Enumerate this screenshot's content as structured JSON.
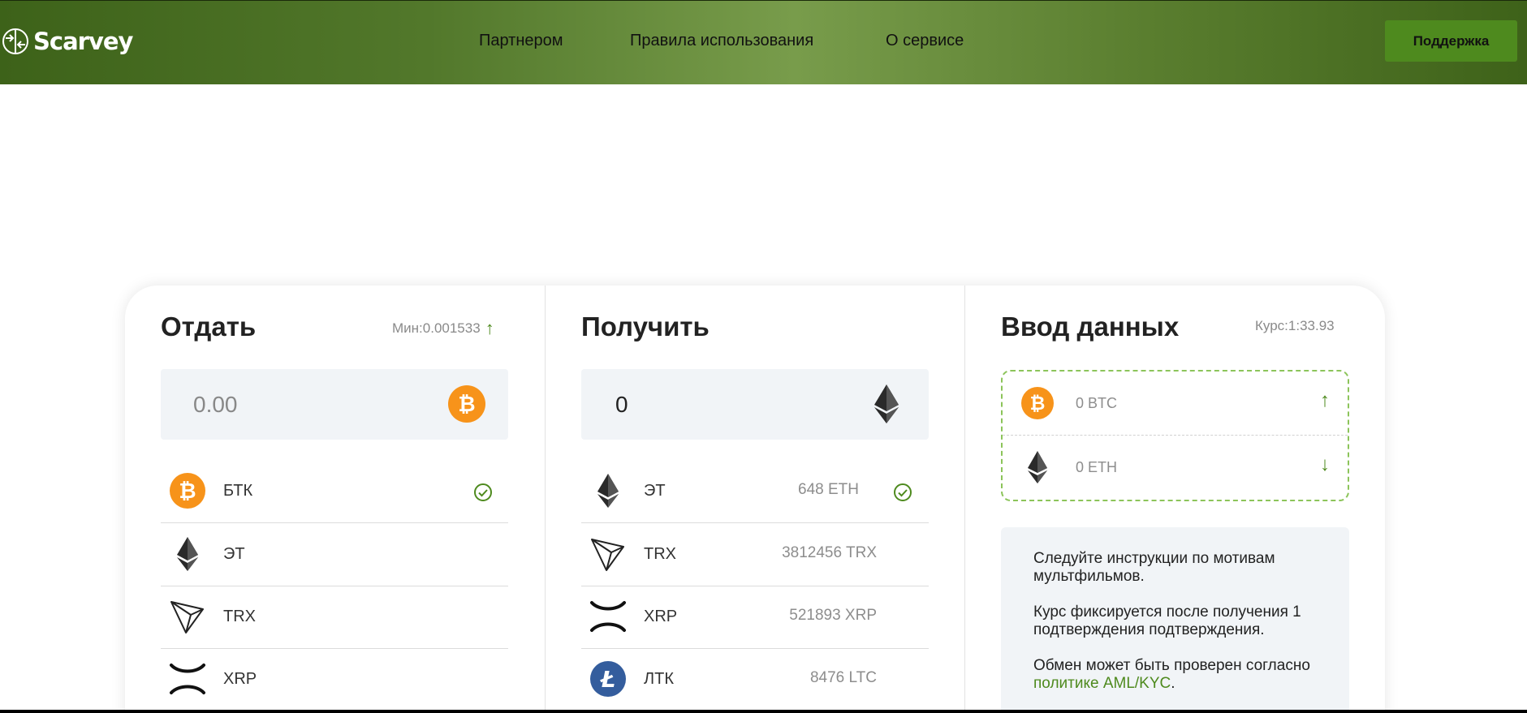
{
  "header": {
    "logo_text": "Scarvey",
    "nav": [
      "Партнером",
      "Правила использования",
      "О сервисе"
    ],
    "support_label": "Поддержка"
  },
  "give": {
    "title": "Отдать",
    "min_label": "Мин:0.001533",
    "amount": "0.00",
    "coins": [
      {
        "name": "БТК",
        "icon": "bitcoin-icon",
        "selected": true
      },
      {
        "name": "ЭТ",
        "icon": "ethereum-icon",
        "selected": false
      },
      {
        "name": "TRX",
        "icon": "tron-icon",
        "selected": false
      },
      {
        "name": "XRP",
        "icon": "xrp-icon",
        "selected": false
      }
    ]
  },
  "get": {
    "title": "Получить",
    "amount": "0",
    "coins": [
      {
        "name": "ЭТ",
        "reserve": "648 ETH",
        "icon": "ethereum-icon",
        "selected": true
      },
      {
        "name": "TRX",
        "reserve": "3812456 TRX",
        "icon": "tron-icon",
        "selected": false
      },
      {
        "name": "XRP",
        "reserve": "521893 XRP",
        "icon": "xrp-icon",
        "selected": false
      },
      {
        "name": "ЛТК",
        "reserve": "8476 LTC",
        "icon": "litecoin-icon",
        "selected": false
      }
    ]
  },
  "data_entry": {
    "title": "Ввод данных",
    "rate_label": "Курс:1:33.93",
    "send_amount": "0 BTC",
    "receive_amount": "0 ETH",
    "info": {
      "p1": "Следуйте инструкции по мотивам мультфильмов.",
      "p2": "Курс фиксируется после получения 1 подтверждения подтверждения.",
      "p3_prefix": "Обмен может быть проверен согласно ",
      "p3_link": "политике AML/KYC",
      "p3_suffix": "."
    }
  },
  "colors": {
    "accent": "#4e8a1e",
    "bitcoin": "#f7931a",
    "litecoin": "#345d9d",
    "panel": "#f1f4f7"
  }
}
